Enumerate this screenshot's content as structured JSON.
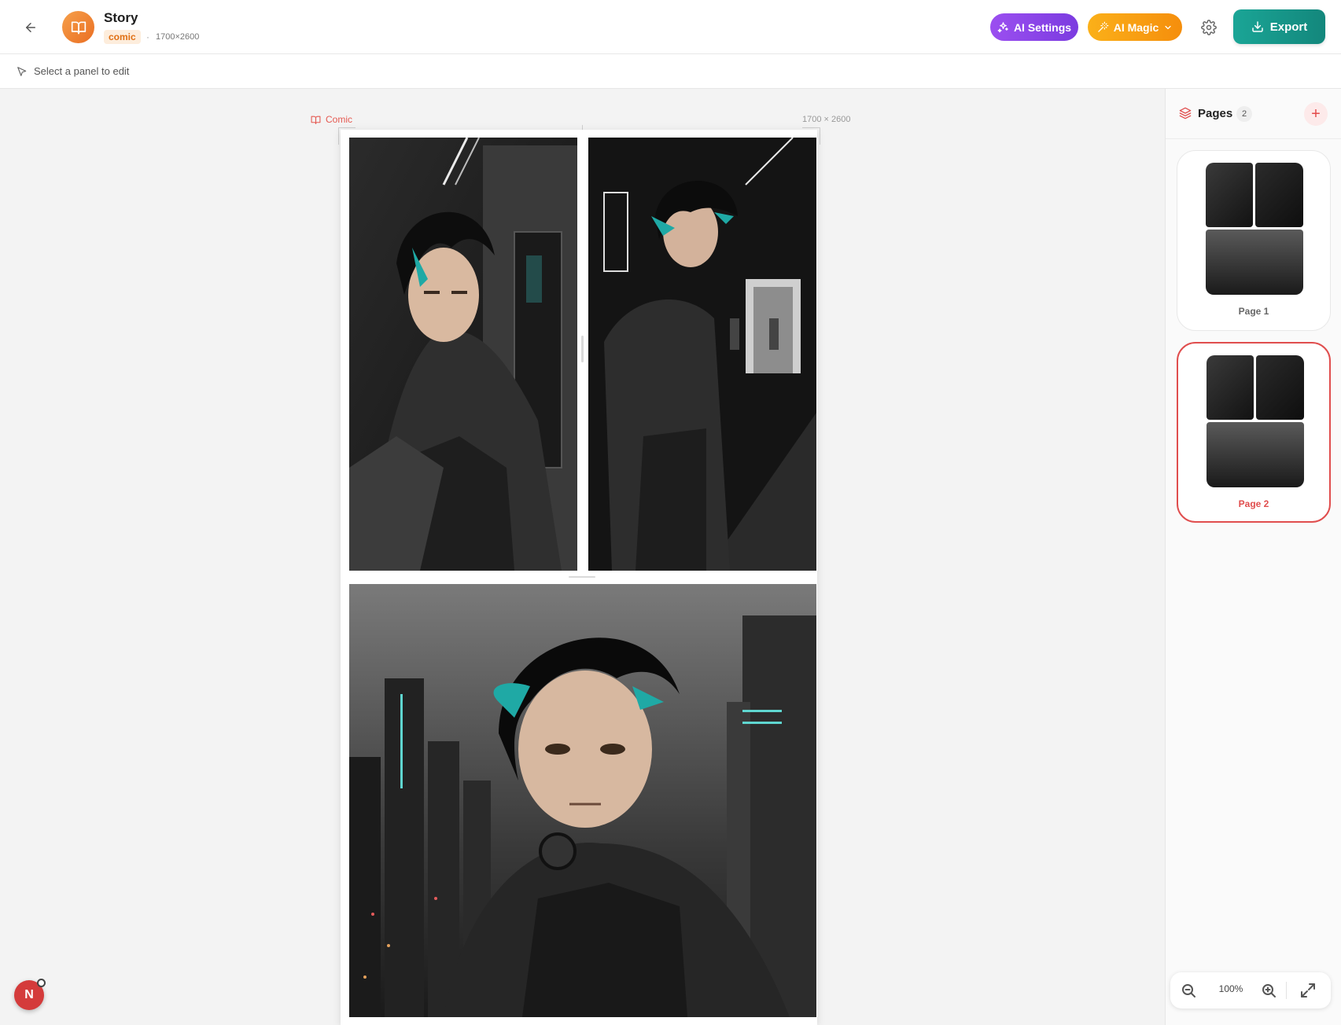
{
  "header": {
    "title": "Story",
    "type_badge": "comic",
    "separator": "·",
    "dimensions": "1700×2600",
    "ai_settings_label": "AI Settings",
    "ai_magic_label": "AI Magic",
    "export_label": "Export"
  },
  "toolbar": {
    "hint": "Select a panel to edit"
  },
  "canvas": {
    "type_label": "Comic",
    "size_label": "1700 × 2600"
  },
  "sidebar": {
    "title": "Pages",
    "count": "2",
    "add_label": "+",
    "pages": [
      {
        "label": "Page 1",
        "active": false
      },
      {
        "label": "Page 2",
        "active": true
      }
    ]
  },
  "zoom": {
    "level": "100%"
  },
  "user": {
    "initial": "N"
  },
  "colors": {
    "accent": "#e04e4e",
    "ai_settings": "#8a45e8",
    "ai_magic": "#f79e12",
    "export": "#17988b",
    "brand": "#ef7f2c"
  }
}
